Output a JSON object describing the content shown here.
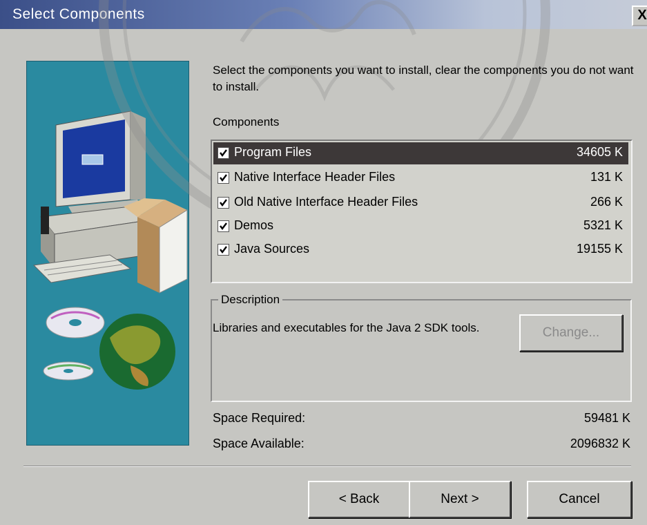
{
  "window": {
    "title": "Select Components",
    "close_label": "X"
  },
  "intro": {
    "text": "Select the components you want to install, clear the components you do not want to install."
  },
  "components": {
    "label": "Components",
    "items": [
      {
        "name": "Program Files",
        "size": "34605 K",
        "checked": true,
        "selected": true
      },
      {
        "name": "Native Interface Header Files",
        "size": "131 K",
        "checked": true,
        "selected": false
      },
      {
        "name": "Old Native  Interface Header Files",
        "size": "266 K",
        "checked": true,
        "selected": false
      },
      {
        "name": "Demos",
        "size": "5321 K",
        "checked": true,
        "selected": false
      },
      {
        "name": "Java Sources",
        "size": "19155 K",
        "checked": true,
        "selected": false
      }
    ]
  },
  "description": {
    "legend": "Description",
    "text": "Libraries and executables for the Java 2 SDK tools.",
    "change_label": "Change..."
  },
  "space": {
    "required_label": "Space Required:",
    "required_value": "59481 K",
    "available_label": "Space Available:",
    "available_value": "2096832 K"
  },
  "buttons": {
    "back": "< Back",
    "next": "Next >",
    "cancel": "Cancel"
  },
  "colors": {
    "title_bar": "#3b4f88",
    "selection": "#3d3838",
    "side_panel": "#2a8aa0"
  }
}
